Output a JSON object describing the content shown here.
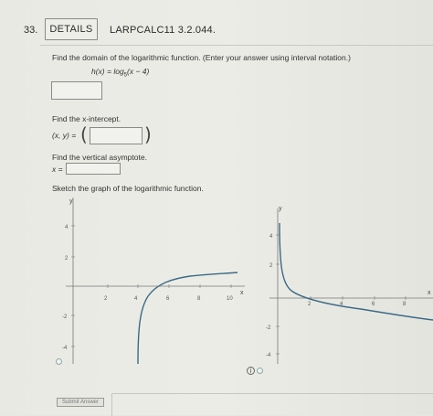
{
  "question": {
    "number": "33.",
    "details_label": "DETAILS",
    "code": "LARPCALC11 3.2.044."
  },
  "part1": {
    "instruction": "Find the domain of the logarithmic function. (Enter your answer using interval notation.)",
    "function_prefix": "h(x) = log",
    "function_base": "5",
    "function_arg": "(x − 4)",
    "answer_value": ""
  },
  "part2": {
    "label": "Find the x-intercept.",
    "coord_label": "(x, y) =",
    "answer_value": ""
  },
  "part3": {
    "label": "Find the vertical asymptote.",
    "var_label": "x =",
    "answer_value": ""
  },
  "part4": {
    "label": "Sketch the graph of the logarithmic function."
  },
  "graph_left": {
    "x_axis_label": "x",
    "y_axis_label": "y",
    "x_ticks": [
      "2",
      "4",
      "6",
      "8",
      "10"
    ],
    "y_ticks": [
      "4",
      "2",
      "-2",
      "-4"
    ],
    "curve_color": "#3a6b86"
  },
  "graph_right": {
    "x_axis_label": "x",
    "y_axis_label": "y",
    "x_ticks": [
      "2",
      "4",
      "6",
      "8"
    ],
    "y_ticks": [
      "4",
      "2",
      "-2",
      "-4"
    ],
    "curve_color": "#3a6b86"
  },
  "buttons": {
    "submit_label": "Submit Answer"
  },
  "icons": {
    "info": "i"
  }
}
